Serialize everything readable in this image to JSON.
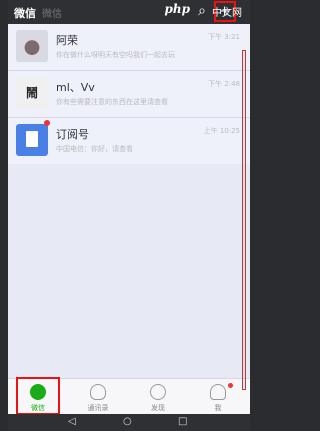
{
  "status": {
    "title": "微信",
    "title_dim": "微信",
    "brand": "php",
    "brand_cn": "中文网",
    "plus": "+"
  },
  "chats": [
    {
      "name": "阿荣",
      "preview": "你在做什么呀明天有空吗我们一起去玩",
      "time": "下午 3:21"
    },
    {
      "name": "ml、Vv",
      "preview": "你有些需要注意的东西在这里请查看",
      "time": "下午 2:48"
    },
    {
      "name": "订阅号",
      "preview": "中国电信：你好，请查看",
      "time": "上午 10:25"
    }
  ],
  "tabs": [
    {
      "label": "微信"
    },
    {
      "label": "通讯录"
    },
    {
      "label": "发现"
    },
    {
      "label": "我"
    }
  ],
  "navbar": {
    "back": "◁",
    "home": "○",
    "recent": "□"
  }
}
